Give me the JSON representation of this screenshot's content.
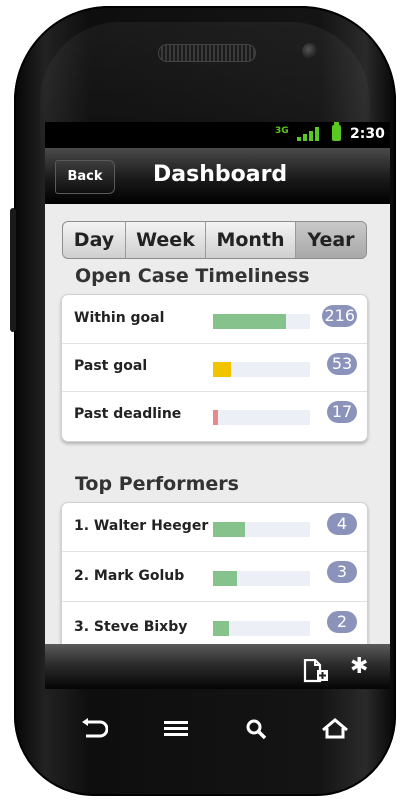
{
  "status_bar": {
    "network": "3G",
    "time": "2:30"
  },
  "header": {
    "back_label": "Back",
    "title": "Dashboard"
  },
  "period_tabs": [
    {
      "label": "Day",
      "active": false
    },
    {
      "label": "Week",
      "active": false
    },
    {
      "label": "Month",
      "active": false
    },
    {
      "label": "Year",
      "active": true
    }
  ],
  "open_case_timeliness": {
    "title": "Open Case Timeliness",
    "rows": [
      {
        "label": "Within goal",
        "count": "216",
        "fill_percent": 75,
        "color": "#86c28c"
      },
      {
        "label": "Past goal",
        "count": "53",
        "fill_percent": 19,
        "color": "#f2c400"
      },
      {
        "label": "Past deadline",
        "count": "17",
        "fill_percent": 5,
        "color": "#e48a8a"
      }
    ]
  },
  "top_performers": {
    "title": "Top Performers",
    "rows": [
      {
        "label": "1. Walter Heeger",
        "count": "4",
        "fill_percent": 33,
        "color": "#86c28c"
      },
      {
        "label": "2. Mark Golub",
        "count": "3",
        "fill_percent": 25,
        "color": "#86c28c"
      },
      {
        "label": "3. Steve Bixby",
        "count": "2",
        "fill_percent": 16,
        "color": "#86c28c"
      }
    ]
  },
  "toolbar": {
    "icons": [
      "add-document-icon",
      "gear-icon"
    ]
  },
  "device_keys": [
    "back-arrow-icon",
    "menu-icon",
    "search-icon",
    "home-icon"
  ]
}
